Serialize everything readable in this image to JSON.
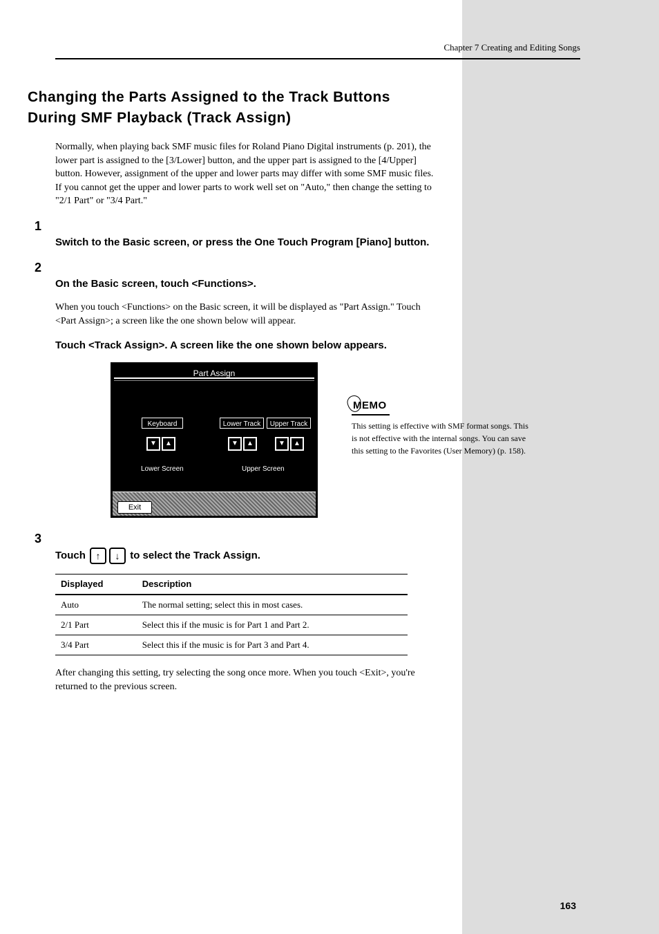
{
  "chapter_header": "Chapter 7 Creating and Editing Songs",
  "section_title": "Changing the Parts Assigned to the Track Buttons During SMF Playback (Track Assign)",
  "intro": "Normally, when playing back SMF music files for Roland Piano Digital instruments (p. 201), the lower part is assigned to the [3/Lower] button, and the upper part is assigned to the [4/Upper] button. However, assignment of the upper and lower parts may differ with some SMF music files. If you cannot get the upper and lower parts to work well set on \"Auto,\" then change the setting to \"2/1 Part\" or \"3/4 Part.\"",
  "steps": [
    {
      "num": "1",
      "text": "Switch to the Basic screen, or press the One Touch Program [Piano] button."
    },
    {
      "num": "2",
      "text": "On the Basic screen, touch <Functions>."
    },
    {
      "num_note": "When you touch <Functions> on the Basic screen, it will be displayed as \"Part Assign.\" Touch <Part Assign>; a screen like the one shown below will appear.",
      "body": "Touch <Track Assign>. A screen like the one shown below appears."
    }
  ],
  "lcd": {
    "title": "Part Assign",
    "keyboard_label": "Keyboard",
    "lower_track_label": "Lower Track",
    "upper_track_label": "Upper Track",
    "lower_screen": "Lower Screen",
    "upper_screen": "Upper Screen",
    "exit": "Exit"
  },
  "step3_lead": "Touch ",
  "step3_tail": " to select the Track Assign.",
  "table": {
    "headers": [
      "Displayed",
      "Description"
    ],
    "rows": [
      [
        "Auto",
        "The normal setting; select this in most cases."
      ],
      [
        "2/1 Part",
        "Select this if the music is for Part 1 and Part 2."
      ],
      [
        "3/4 Part",
        "Select this if the music is for Part 3 and Part 4."
      ]
    ]
  },
  "after_table": "After changing this setting, try selecting the song once more. When you touch <Exit>, you're returned to the previous screen.",
  "memo": {
    "tag": "MEMO",
    "text": "This setting is effective with SMF format songs. This is not effective with the internal songs. You can save this setting to the Favorites (User Memory) (p. 158)."
  },
  "page_number": "163"
}
